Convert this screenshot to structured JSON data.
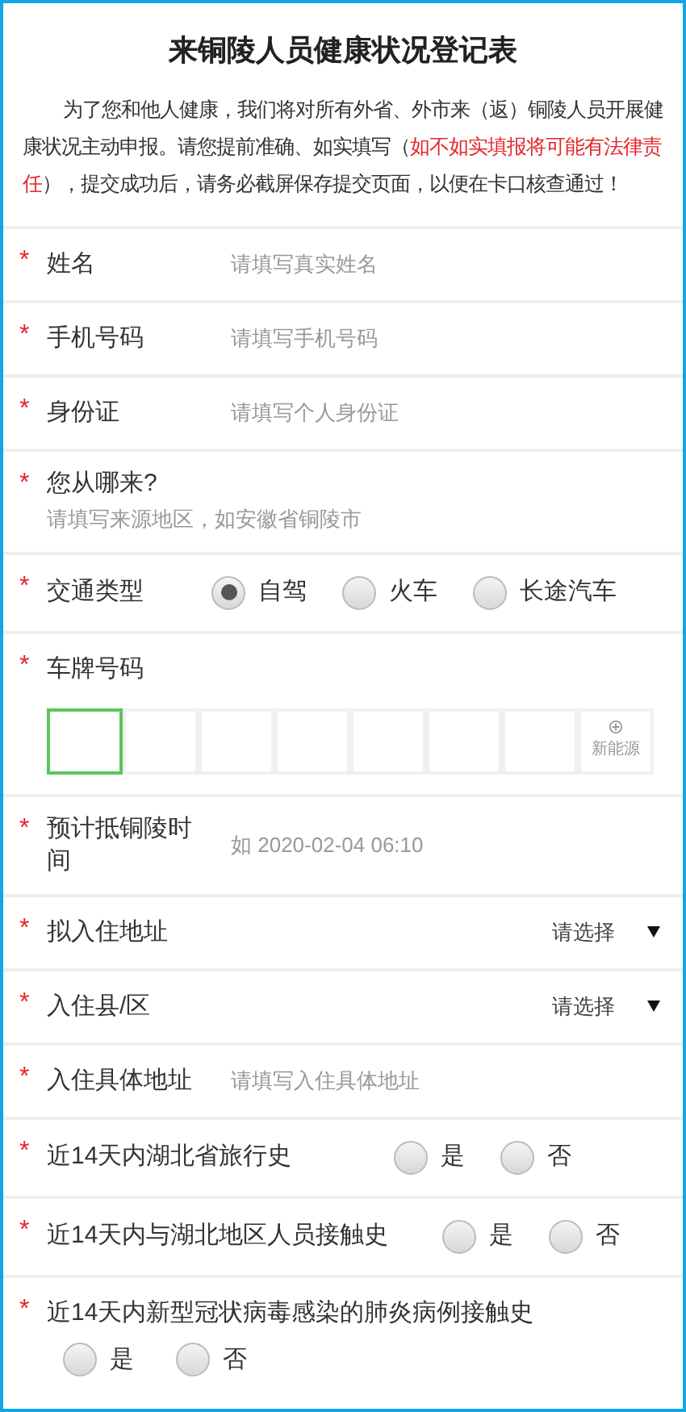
{
  "title": "来铜陵人员健康状况登记表",
  "intro": [
    {
      "text": "为了您和他人健康，我们将对所有外省、外市来（返）铜陵人员开展健康状况主动申报。请您提前准确、如实填写（",
      "warning": false
    },
    {
      "text": "如不如实填报将可能有法律责任",
      "warning": true
    },
    {
      "text": "），提交成功后，请务必截屏保存提交页面，以便在卡口核查通过！",
      "warning": false
    }
  ],
  "fields": [
    {
      "kind": "text",
      "required_mark": "*",
      "label": "姓名",
      "placeholder": "请填写真实姓名"
    },
    {
      "kind": "text",
      "required_mark": "*",
      "label": "手机号码",
      "placeholder": "请填写手机号码"
    },
    {
      "kind": "text",
      "required_mark": "*",
      "label": "身份证",
      "placeholder": "请填写个人身份证"
    },
    {
      "kind": "stacked",
      "required_mark": "*",
      "label": "您从哪来?",
      "placeholder": "请填写来源地区，如安徽省铜陵市"
    },
    {
      "kind": "radio",
      "required_mark": "*",
      "label": "交通类型",
      "options": [
        {
          "label": "自驾",
          "selected": true
        },
        {
          "label": "火车",
          "selected": false
        },
        {
          "label": "长途汽车",
          "selected": false
        }
      ]
    },
    {
      "kind": "plate",
      "required_mark": "*",
      "label": "车牌号码",
      "cells": [
        {
          "selected": true
        },
        {
          "selected": false
        },
        {
          "selected": false
        },
        {
          "selected": false
        },
        {
          "selected": false
        },
        {
          "selected": false
        },
        {
          "selected": false
        },
        {
          "selected": false,
          "label": "新能源"
        }
      ]
    },
    {
      "kind": "text",
      "required_mark": "*",
      "label": "预计抵铜陵时间",
      "placeholder": "如 2020-02-04 06:10"
    },
    {
      "kind": "select",
      "required_mark": "*",
      "label": "拟入住地址",
      "value": "请选择"
    },
    {
      "kind": "select",
      "required_mark": "*",
      "label": "入住县/区",
      "value": "请选择"
    },
    {
      "kind": "text",
      "required_mark": "*",
      "label": "入住具体地址",
      "placeholder": "请填写入住具体地址"
    },
    {
      "kind": "radio",
      "required_mark": "*",
      "label": "近14天内湖北省旅行史",
      "options": [
        {
          "label": "是",
          "selected": false
        },
        {
          "label": "否",
          "selected": false
        }
      ]
    },
    {
      "kind": "radio",
      "required_mark": "*",
      "label": "近14天内与湖北地区人员接触史",
      "options": [
        {
          "label": "是",
          "selected": false
        },
        {
          "label": "否",
          "selected": false
        }
      ]
    },
    {
      "kind": "radio_below",
      "required_mark": "*",
      "label": "近14天内新型冠状病毒感染的肺炎病例接触史",
      "options": [
        {
          "label": "是",
          "selected": false
        },
        {
          "label": "否",
          "selected": false
        }
      ]
    }
  ]
}
